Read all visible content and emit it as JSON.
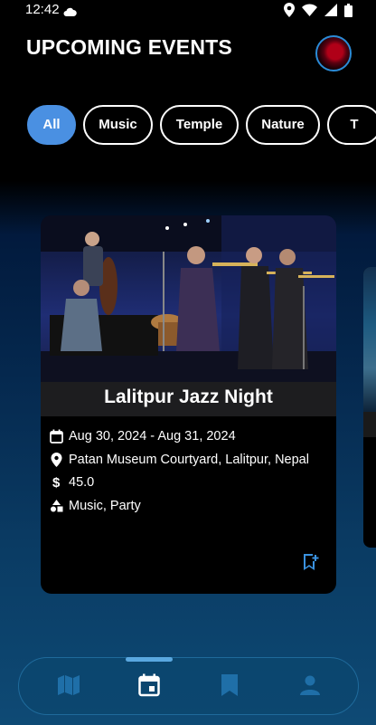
{
  "status_bar": {
    "time": "12:42"
  },
  "header": {
    "title": "UPCOMING EVENTS"
  },
  "filters": [
    {
      "label": "All",
      "active": true
    },
    {
      "label": "Music",
      "active": false
    },
    {
      "label": "Temple",
      "active": false
    },
    {
      "label": "Nature",
      "active": false
    },
    {
      "label": "T",
      "active": false
    }
  ],
  "event": {
    "title": "Lalitpur Jazz Night",
    "date": "Aug 30, 2024 - Aug 31, 2024",
    "location": "Patan Museum Courtyard, Lalitpur, Nepal",
    "price": "45.0",
    "categories": "Music, Party",
    "image": "jazz-band-photo"
  },
  "bottom_nav": [
    {
      "name": "map-icon",
      "active": false
    },
    {
      "name": "calendar-icon",
      "active": true
    },
    {
      "name": "bookmark-icon",
      "active": false
    },
    {
      "name": "profile-icon",
      "active": false
    }
  ],
  "colors": {
    "accent": "#4a90e2",
    "nav_bg": "#0c466e",
    "card_bg": "#000000"
  }
}
